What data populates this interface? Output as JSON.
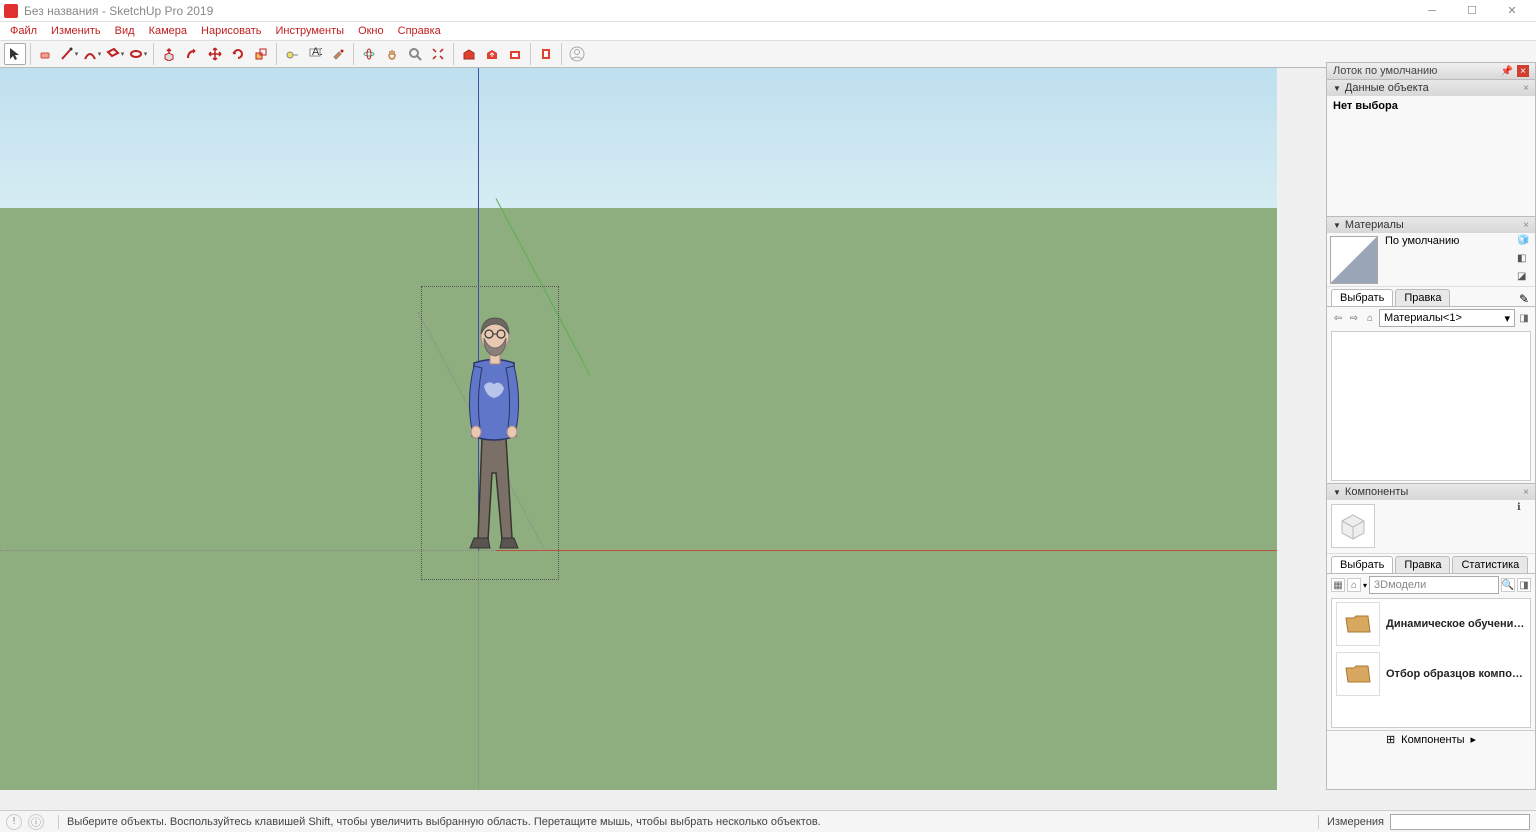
{
  "app": {
    "title": "Без названия - SketchUp Pro 2019"
  },
  "menu": [
    "Файл",
    "Изменить",
    "Вид",
    "Камера",
    "Нарисовать",
    "Инструменты",
    "Окно",
    "Справка"
  ],
  "tray": {
    "title": "Лоток по умолчанию",
    "panels": {
      "entity": {
        "title": "Данные объекта",
        "noSelection": "Нет выбора"
      },
      "materials": {
        "title": "Материалы",
        "defaultName": "По умолчанию",
        "tabs": [
          "Выбрать",
          "Правка"
        ],
        "combo": "Материалы<1>"
      },
      "components": {
        "title": "Компоненты",
        "tabs": [
          "Выбрать",
          "Правка",
          "Статистика"
        ],
        "searchPlaceholder": "3Dмодели",
        "items": [
          "Динамическое обучение ком...",
          "Отбор образцов компонентов"
        ],
        "footerLabel": "Компоненты"
      }
    }
  },
  "status": {
    "hint": "Выберите объекты. Воспользуйтесь клавишей Shift, чтобы увеличить выбранную область. Перетащите мышь, чтобы выбрать несколько объектов.",
    "measurementsLabel": "Измерения"
  }
}
